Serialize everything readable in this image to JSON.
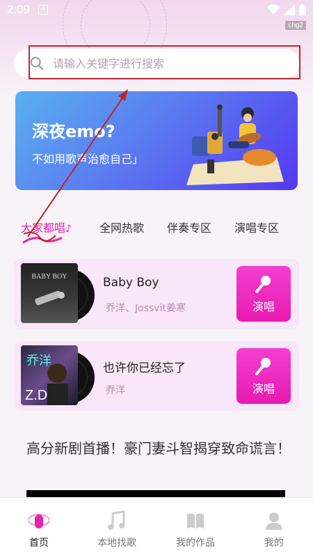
{
  "status_bar": {
    "time": "2:09",
    "badge": "chg2"
  },
  "search": {
    "placeholder": "请输入关键字进行搜索"
  },
  "banner": {
    "title": "深夜emo?",
    "subtitle": "不如用歌声治愈自己」"
  },
  "tabs": [
    {
      "label": "大家都唱",
      "active": true
    },
    {
      "label": "全网热歌",
      "active": false
    },
    {
      "label": "伴奏专区",
      "active": false
    },
    {
      "label": "演唱专区",
      "active": false
    }
  ],
  "songs": [
    {
      "title": "Baby Boy",
      "artist": "乔洋、Jossvit姜寒",
      "cover_text": "BABY BOY",
      "button": "演唱"
    },
    {
      "title": "也许你已经忘了",
      "artist": "乔洋",
      "cover_text": "乔洋",
      "button": "演唱"
    }
  ],
  "news": {
    "title": "高分新剧首播！豪门妻斗智揭穿致命谎言！"
  },
  "bottom_nav": [
    {
      "label": "首页",
      "icon": "microphone-icon",
      "active": true
    },
    {
      "label": "本地找歌",
      "icon": "music-note-icon",
      "active": false
    },
    {
      "label": "我的作品",
      "icon": "book-icon",
      "active": false
    },
    {
      "label": "我的",
      "icon": "person-icon",
      "active": false
    }
  ],
  "colors": {
    "accent": "#e626a8",
    "annotation": "#c0252a"
  }
}
